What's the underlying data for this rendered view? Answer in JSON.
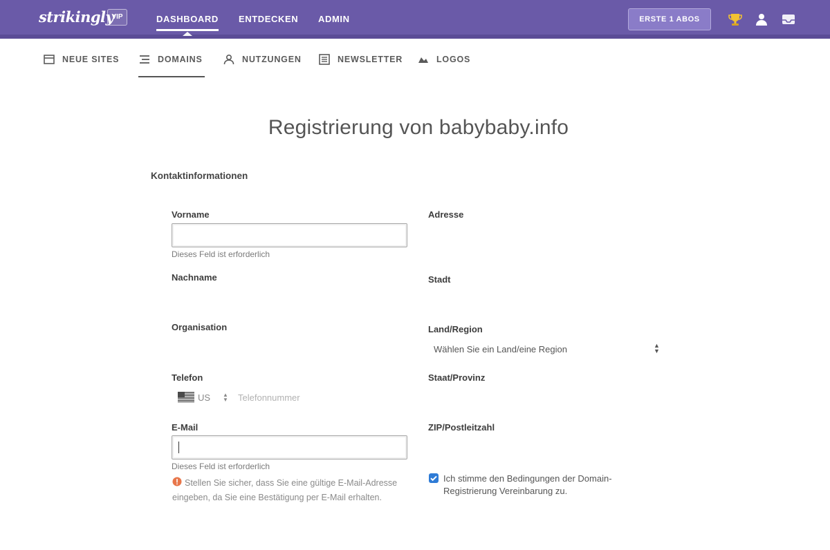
{
  "topbar": {
    "logo": "strikingly",
    "badge": "VIP",
    "nav": [
      "DASHBOARD",
      "ENTDECKEN",
      "ADMIN"
    ],
    "abo_button": "ERSTE 1 ABOS",
    "icons": [
      "trophy-icon",
      "user-icon",
      "inbox-icon"
    ]
  },
  "subnav": [
    {
      "label": "NEUE SITES",
      "icon": "sites-icon"
    },
    {
      "label": "DOMAINS",
      "icon": "domains-icon",
      "active": true
    },
    {
      "label": "NUTZUNGEN",
      "icon": "users-icon"
    },
    {
      "label": "NEWSLETTER",
      "icon": "newsletter-icon"
    },
    {
      "label": "LOGOS",
      "icon": "logos-icon"
    }
  ],
  "page": {
    "title": "Registrierung von babybaby.info",
    "section": "Kontaktinformationen"
  },
  "form": {
    "firstname": {
      "label": "Vorname",
      "value": "",
      "error": "Dieses Feld ist erforderlich"
    },
    "lastname": {
      "label": "Nachname"
    },
    "organisation": {
      "label": "Organisation"
    },
    "phone": {
      "label": "Telefon",
      "country_code": "US",
      "placeholder": "Telefonnummer"
    },
    "email": {
      "label": "E-Mail",
      "value": "",
      "error": "Dieses Feld ist erforderlich",
      "warning": "Stellen Sie sicher, dass Sie eine gültige E-Mail-Adresse eingeben, da Sie eine Bestätigung per E-Mail erhalten."
    },
    "address": {
      "label": "Adresse"
    },
    "city": {
      "label": "Stadt"
    },
    "country": {
      "label": "Land/Region",
      "selected": "Wählen Sie ein Land/eine Region"
    },
    "state": {
      "label": "Staat/Provinz"
    },
    "zip": {
      "label": "ZIP/Postleitzahl"
    },
    "consent": {
      "checked": true,
      "text": "Ich stimme den Bedingungen der Domain-Registrierung Vereinbarung zu."
    }
  },
  "colors": {
    "topbar": "#6a5aa8",
    "button": "#8a7cc8",
    "checkbox": "#2e7bd6",
    "warning": "#e8764a"
  }
}
